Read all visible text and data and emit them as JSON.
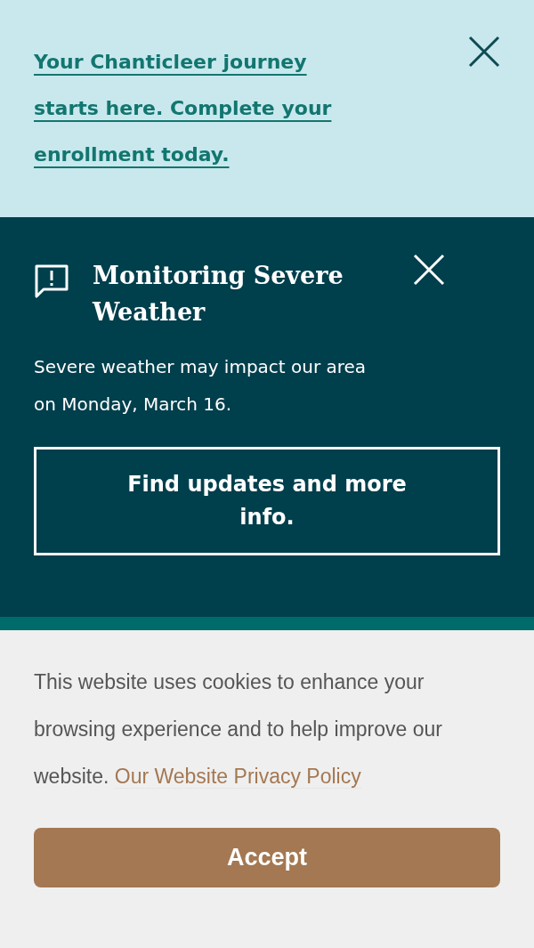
{
  "enrollment_banner": {
    "link": "Your Chanticleer journey starts here. Complete your enrollment today."
  },
  "alert": {
    "title": "Monitoring Severe Weather",
    "message": "Severe weather may impact our area on Monday, March 16.",
    "button": "Find updates and more info."
  },
  "cookie_notice": {
    "text": "This website uses cookies to enhance your browsing experience and to help improve our website.",
    "link": "Our Website Privacy Policy",
    "button": "Accept"
  }
}
